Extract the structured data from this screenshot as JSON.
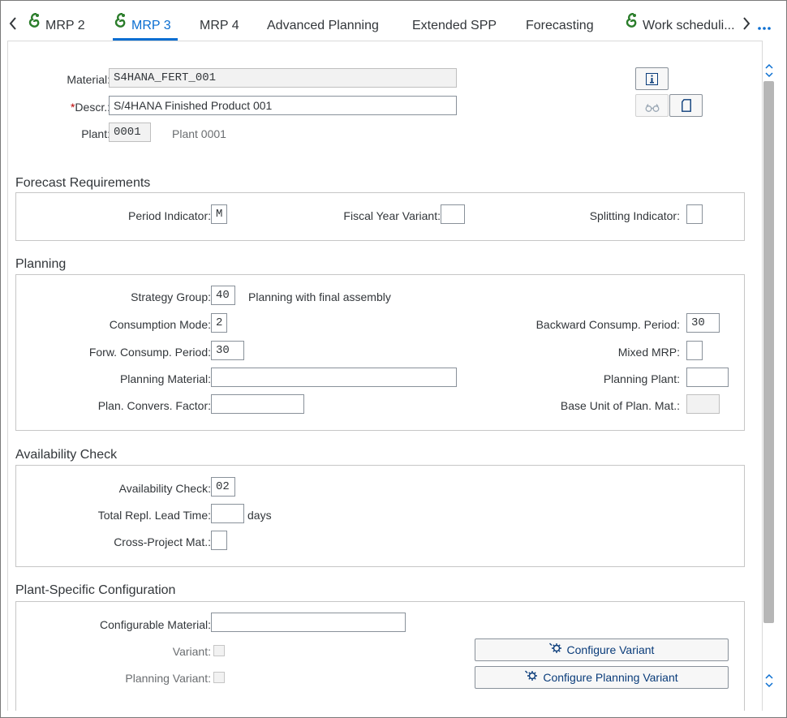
{
  "tabs": {
    "prev_label": "‹",
    "next_label": "›",
    "more_label": "…",
    "items": [
      {
        "label": "MRP 2"
      },
      {
        "label": "MRP 3"
      },
      {
        "label": "MRP 4"
      },
      {
        "label": "Advanced Planning"
      },
      {
        "label": "Extended SPP"
      },
      {
        "label": "Forecasting"
      },
      {
        "label": "Work scheduli..."
      }
    ]
  },
  "header": {
    "material_label": "Material:",
    "material_value": "S4HANA_FERT_001",
    "descr_required_mark": "*",
    "descr_label": "Descr.:",
    "descr_value": "S/4HANA Finished Product 001",
    "plant_label": "Plant:",
    "plant_value": "0001",
    "plant_text": "Plant 0001"
  },
  "forecast": {
    "title": "Forecast Requirements",
    "period_indicator_label": "Period Indicator:",
    "period_indicator_value": "M",
    "fiscal_year_variant_label": "Fiscal Year Variant:",
    "fiscal_year_variant_value": "",
    "splitting_indicator_label": "Splitting Indicator:",
    "splitting_indicator_value": ""
  },
  "planning": {
    "title": "Planning",
    "strategy_group_label": "Strategy Group:",
    "strategy_group_value": "40",
    "strategy_group_text": "Planning with final assembly",
    "consumption_mode_label": "Consumption Mode:",
    "consumption_mode_value": "2",
    "backward_period_label": "Backward Consump. Period:",
    "backward_period_value": "30",
    "forward_period_label": "Forw. Consump. Period:",
    "forward_period_value": "30",
    "mixed_mrp_label": "Mixed MRP:",
    "mixed_mrp_value": "",
    "planning_material_label": "Planning Material:",
    "planning_material_value": "",
    "planning_plant_label": "Planning Plant:",
    "planning_plant_value": "",
    "conv_factor_label": "Plan. Convers. Factor:",
    "conv_factor_value": "",
    "base_unit_label": "Base Unit of Plan. Mat.:",
    "base_unit_value": ""
  },
  "availability": {
    "title": "Availability Check",
    "check_label": "Availability Check:",
    "check_value": "02",
    "lead_time_label": "Total Repl. Lead Time:",
    "lead_time_value": "",
    "lead_time_unit": "days",
    "cross_project_label": "Cross-Project Mat.:",
    "cross_project_value": ""
  },
  "plant_config": {
    "title": "Plant-Specific Configuration",
    "configurable_material_label": "Configurable Material:",
    "configurable_material_value": "",
    "variant_label": "Variant:",
    "planning_variant_label": "Planning Variant:",
    "configure_variant_label": "Configure Variant",
    "configure_planning_variant_label": "Configure Planning Variant"
  },
  "colors": {
    "accent": "#0a6ed1",
    "required": "#bb0000",
    "tab_icon_green": "#2b7d2b"
  },
  "icons": [
    "chevron-left-icon",
    "chevron-right-icon",
    "more-icon",
    "tab-status-icon",
    "info-icon",
    "display-glasses-icon",
    "document-icon",
    "gear-configure-icon"
  ]
}
